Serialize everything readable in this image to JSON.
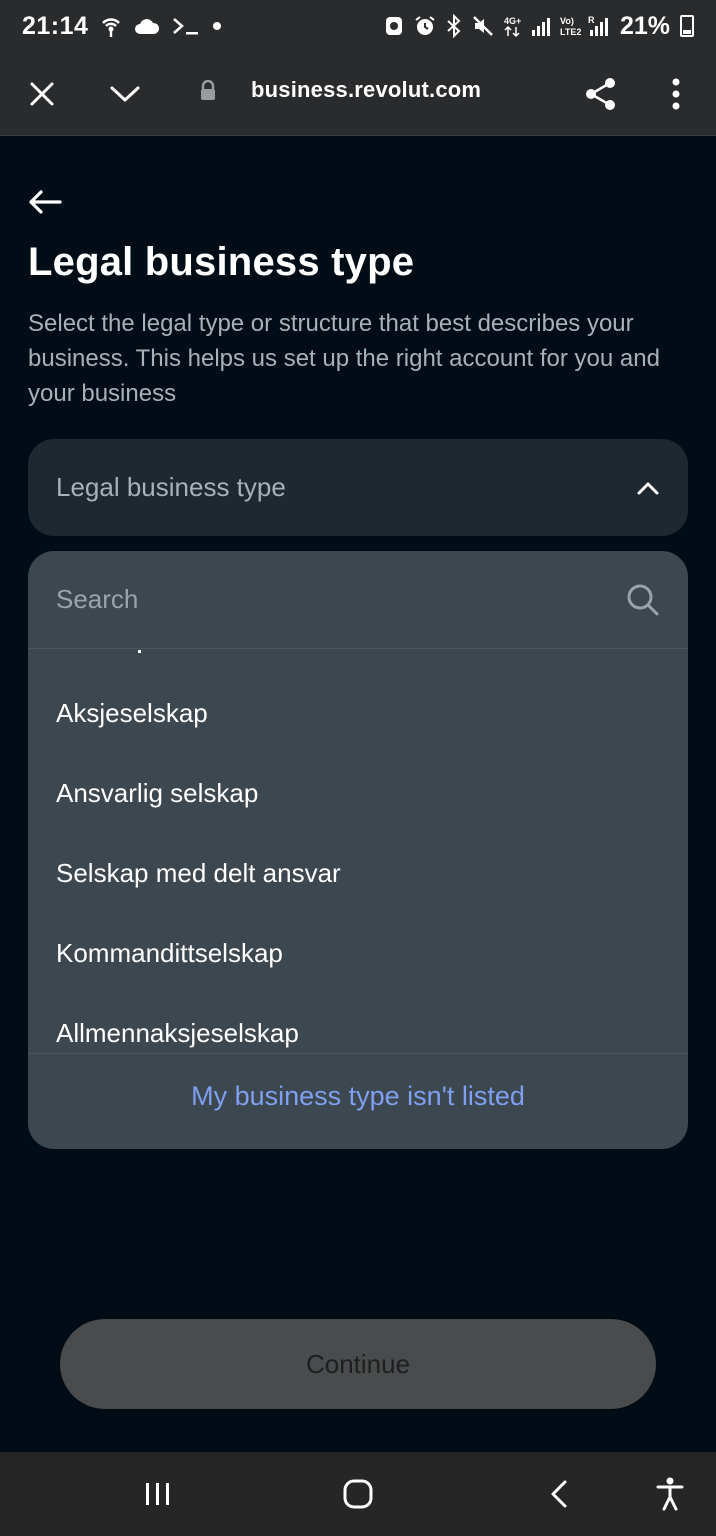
{
  "status_bar": {
    "time": "21:14",
    "battery": "21%"
  },
  "browser": {
    "url": "business.revolut.com"
  },
  "page": {
    "title": "Legal business type",
    "description": "Select the legal type or structure that best describes your business. This helps us set up the right account for you and your business"
  },
  "select": {
    "label": "Legal business type"
  },
  "dropdown": {
    "search_placeholder": "Search",
    "options": [
      "Aksjeselskap",
      "Ansvarlig selskap",
      "Selskap med delt ansvar",
      "Kommandittselskap",
      "Allmennaksjeselskap"
    ],
    "not_listed": "My business type isn't listed"
  },
  "continue_label": "Continue",
  "colors": {
    "background": "#000d16",
    "dropdown_bg": "#3d474f",
    "link": "#7f9ff0"
  }
}
